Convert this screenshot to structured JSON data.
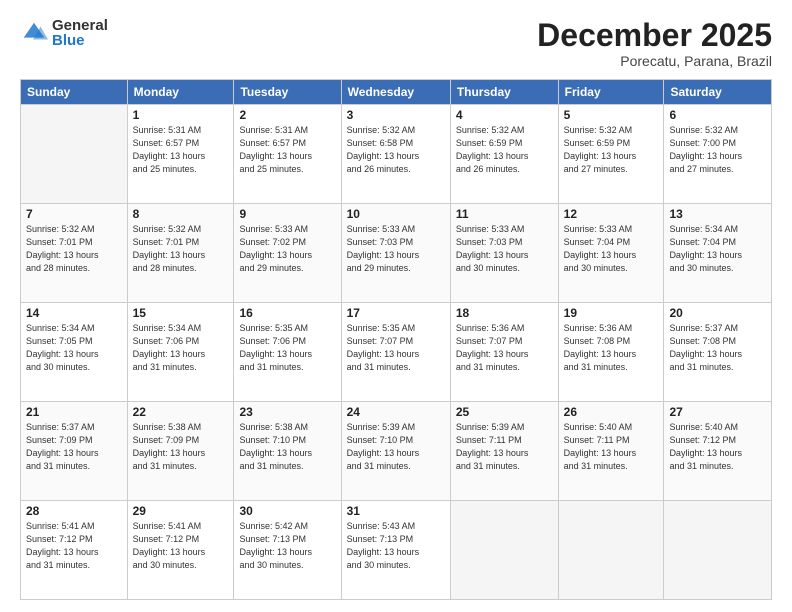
{
  "logo": {
    "general": "General",
    "blue": "Blue"
  },
  "header": {
    "month": "December 2025",
    "location": "Porecatu, Parana, Brazil"
  },
  "weekdays": [
    "Sunday",
    "Monday",
    "Tuesday",
    "Wednesday",
    "Thursday",
    "Friday",
    "Saturday"
  ],
  "weeks": [
    [
      {
        "day": "",
        "empty": true
      },
      {
        "day": "1",
        "sunrise": "Sunrise: 5:31 AM",
        "sunset": "Sunset: 6:57 PM",
        "daylight": "Daylight: 13 hours and 25 minutes."
      },
      {
        "day": "2",
        "sunrise": "Sunrise: 5:31 AM",
        "sunset": "Sunset: 6:57 PM",
        "daylight": "Daylight: 13 hours and 25 minutes."
      },
      {
        "day": "3",
        "sunrise": "Sunrise: 5:32 AM",
        "sunset": "Sunset: 6:58 PM",
        "daylight": "Daylight: 13 hours and 26 minutes."
      },
      {
        "day": "4",
        "sunrise": "Sunrise: 5:32 AM",
        "sunset": "Sunset: 6:59 PM",
        "daylight": "Daylight: 13 hours and 26 minutes."
      },
      {
        "day": "5",
        "sunrise": "Sunrise: 5:32 AM",
        "sunset": "Sunset: 6:59 PM",
        "daylight": "Daylight: 13 hours and 27 minutes."
      },
      {
        "day": "6",
        "sunrise": "Sunrise: 5:32 AM",
        "sunset": "Sunset: 7:00 PM",
        "daylight": "Daylight: 13 hours and 27 minutes."
      }
    ],
    [
      {
        "day": "7",
        "sunrise": "Sunrise: 5:32 AM",
        "sunset": "Sunset: 7:01 PM",
        "daylight": "Daylight: 13 hours and 28 minutes."
      },
      {
        "day": "8",
        "sunrise": "Sunrise: 5:32 AM",
        "sunset": "Sunset: 7:01 PM",
        "daylight": "Daylight: 13 hours and 28 minutes."
      },
      {
        "day": "9",
        "sunrise": "Sunrise: 5:33 AM",
        "sunset": "Sunset: 7:02 PM",
        "daylight": "Daylight: 13 hours and 29 minutes."
      },
      {
        "day": "10",
        "sunrise": "Sunrise: 5:33 AM",
        "sunset": "Sunset: 7:03 PM",
        "daylight": "Daylight: 13 hours and 29 minutes."
      },
      {
        "day": "11",
        "sunrise": "Sunrise: 5:33 AM",
        "sunset": "Sunset: 7:03 PM",
        "daylight": "Daylight: 13 hours and 30 minutes."
      },
      {
        "day": "12",
        "sunrise": "Sunrise: 5:33 AM",
        "sunset": "Sunset: 7:04 PM",
        "daylight": "Daylight: 13 hours and 30 minutes."
      },
      {
        "day": "13",
        "sunrise": "Sunrise: 5:34 AM",
        "sunset": "Sunset: 7:04 PM",
        "daylight": "Daylight: 13 hours and 30 minutes."
      }
    ],
    [
      {
        "day": "14",
        "sunrise": "Sunrise: 5:34 AM",
        "sunset": "Sunset: 7:05 PM",
        "daylight": "Daylight: 13 hours and 30 minutes."
      },
      {
        "day": "15",
        "sunrise": "Sunrise: 5:34 AM",
        "sunset": "Sunset: 7:06 PM",
        "daylight": "Daylight: 13 hours and 31 minutes."
      },
      {
        "day": "16",
        "sunrise": "Sunrise: 5:35 AM",
        "sunset": "Sunset: 7:06 PM",
        "daylight": "Daylight: 13 hours and 31 minutes."
      },
      {
        "day": "17",
        "sunrise": "Sunrise: 5:35 AM",
        "sunset": "Sunset: 7:07 PM",
        "daylight": "Daylight: 13 hours and 31 minutes."
      },
      {
        "day": "18",
        "sunrise": "Sunrise: 5:36 AM",
        "sunset": "Sunset: 7:07 PM",
        "daylight": "Daylight: 13 hours and 31 minutes."
      },
      {
        "day": "19",
        "sunrise": "Sunrise: 5:36 AM",
        "sunset": "Sunset: 7:08 PM",
        "daylight": "Daylight: 13 hours and 31 minutes."
      },
      {
        "day": "20",
        "sunrise": "Sunrise: 5:37 AM",
        "sunset": "Sunset: 7:08 PM",
        "daylight": "Daylight: 13 hours and 31 minutes."
      }
    ],
    [
      {
        "day": "21",
        "sunrise": "Sunrise: 5:37 AM",
        "sunset": "Sunset: 7:09 PM",
        "daylight": "Daylight: 13 hours and 31 minutes."
      },
      {
        "day": "22",
        "sunrise": "Sunrise: 5:38 AM",
        "sunset": "Sunset: 7:09 PM",
        "daylight": "Daylight: 13 hours and 31 minutes."
      },
      {
        "day": "23",
        "sunrise": "Sunrise: 5:38 AM",
        "sunset": "Sunset: 7:10 PM",
        "daylight": "Daylight: 13 hours and 31 minutes."
      },
      {
        "day": "24",
        "sunrise": "Sunrise: 5:39 AM",
        "sunset": "Sunset: 7:10 PM",
        "daylight": "Daylight: 13 hours and 31 minutes."
      },
      {
        "day": "25",
        "sunrise": "Sunrise: 5:39 AM",
        "sunset": "Sunset: 7:11 PM",
        "daylight": "Daylight: 13 hours and 31 minutes."
      },
      {
        "day": "26",
        "sunrise": "Sunrise: 5:40 AM",
        "sunset": "Sunset: 7:11 PM",
        "daylight": "Daylight: 13 hours and 31 minutes."
      },
      {
        "day": "27",
        "sunrise": "Sunrise: 5:40 AM",
        "sunset": "Sunset: 7:12 PM",
        "daylight": "Daylight: 13 hours and 31 minutes."
      }
    ],
    [
      {
        "day": "28",
        "sunrise": "Sunrise: 5:41 AM",
        "sunset": "Sunset: 7:12 PM",
        "daylight": "Daylight: 13 hours and 31 minutes."
      },
      {
        "day": "29",
        "sunrise": "Sunrise: 5:41 AM",
        "sunset": "Sunset: 7:12 PM",
        "daylight": "Daylight: 13 hours and 30 minutes."
      },
      {
        "day": "30",
        "sunrise": "Sunrise: 5:42 AM",
        "sunset": "Sunset: 7:13 PM",
        "daylight": "Daylight: 13 hours and 30 minutes."
      },
      {
        "day": "31",
        "sunrise": "Sunrise: 5:43 AM",
        "sunset": "Sunset: 7:13 PM",
        "daylight": "Daylight: 13 hours and 30 minutes."
      },
      {
        "day": "",
        "empty": true
      },
      {
        "day": "",
        "empty": true
      },
      {
        "day": "",
        "empty": true
      }
    ]
  ]
}
